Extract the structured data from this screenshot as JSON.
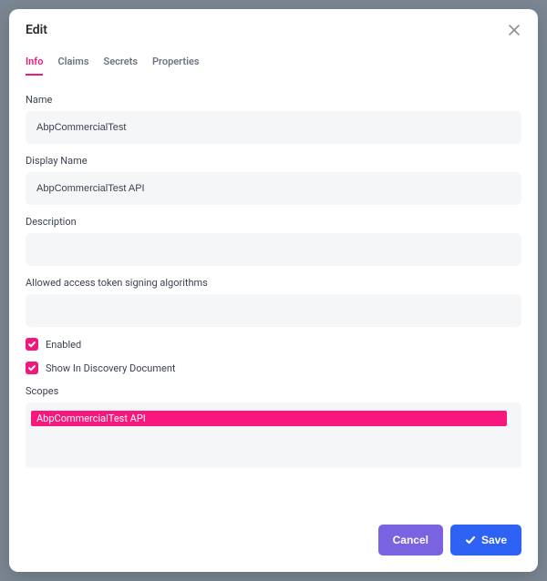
{
  "modal": {
    "title": "Edit"
  },
  "tabs": [
    {
      "label": "Info",
      "active": true
    },
    {
      "label": "Claims",
      "active": false
    },
    {
      "label": "Secrets",
      "active": false
    },
    {
      "label": "Properties",
      "active": false
    }
  ],
  "form": {
    "name_label": "Name",
    "name_value": "AbpCommercialTest",
    "display_name_label": "Display Name",
    "display_name_value": "AbpCommercialTest API",
    "description_label": "Description",
    "description_value": "",
    "algorithms_label": "Allowed access token signing algorithms",
    "algorithms_value": "",
    "enabled_label": "Enabled",
    "enabled_checked": true,
    "discovery_label": "Show In Discovery Document",
    "discovery_checked": true,
    "scopes_label": "Scopes",
    "scopes_selected": "AbpCommercialTest API"
  },
  "footer": {
    "cancel_label": "Cancel",
    "save_label": "Save"
  }
}
